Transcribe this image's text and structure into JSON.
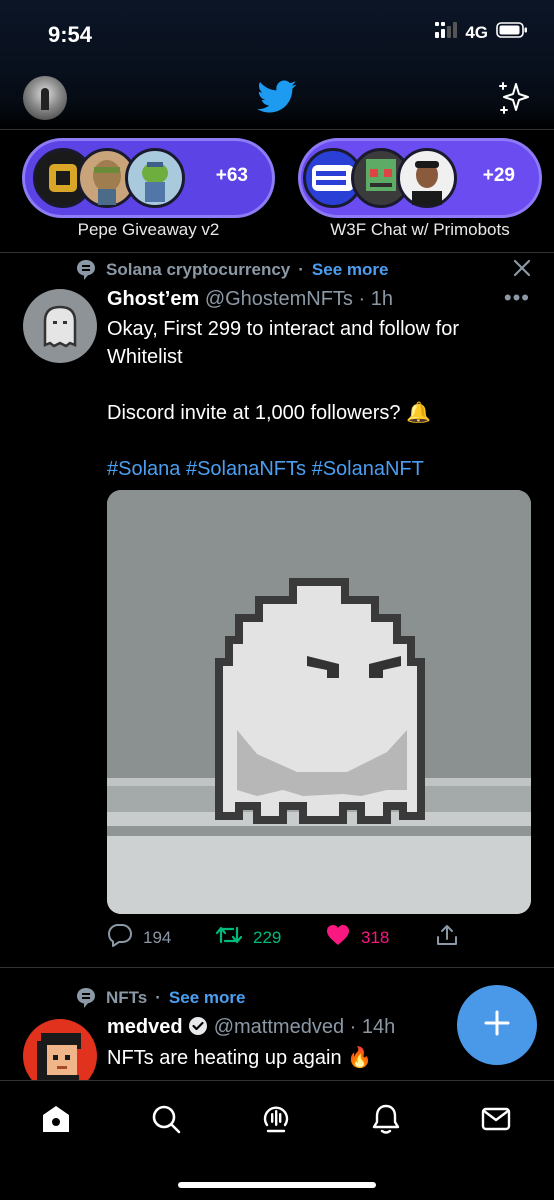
{
  "status_bar": {
    "time": "9:54",
    "network": "4G"
  },
  "spaces": [
    {
      "title": "Pepe Giveaway v2",
      "count": "+63"
    },
    {
      "title": "W3F Chat w/ Primobots",
      "count": "+29"
    }
  ],
  "tweet": {
    "context_topic": "Solana cryptocurrency",
    "context_see_more": "See more",
    "author_name": "Ghost’em",
    "author_handle": "@GhostemNFTs",
    "time": "1h",
    "text_line1": "Okay, First 299 to interact and follow for Whitelist",
    "text_line2": "Discord invite at 1,000 followers? 🔔",
    "hashtags": "#Solana #SolanaNFTs #SolanaNFT",
    "replies": "194",
    "retweets": "229",
    "likes": "318"
  },
  "tweet2": {
    "context_topic": "NFTs",
    "context_see_more": "See more",
    "author_name": "medved",
    "author_handle": "@mattmedved",
    "time": "14h",
    "text": "NFTs are heating up again 🔥"
  },
  "colors": {
    "accent": "#4c9ef0",
    "space_purple": "#5b43e6",
    "retweet_green": "#00ba7c",
    "like_pink": "#f91880"
  },
  "icons": [
    "twitter-bird-icon",
    "sparkle-icon",
    "topic-icon",
    "close-icon",
    "more-icon",
    "reply-icon",
    "retweet-icon",
    "heart-icon",
    "share-icon",
    "verified-icon",
    "compose-plus-icon",
    "home-icon",
    "search-icon",
    "spaces-icon",
    "bell-icon",
    "mail-icon"
  ]
}
